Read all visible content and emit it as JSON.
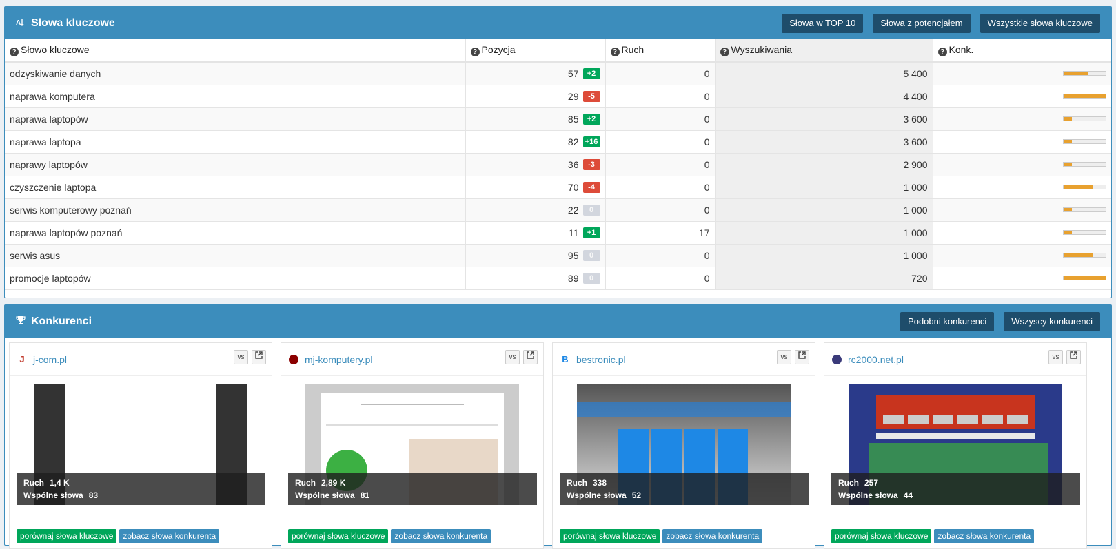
{
  "keywords_panel": {
    "title": "Słowa kluczowe",
    "buttons": [
      "Słowa w TOP 10",
      "Słowa z potencjałem",
      "Wszystkie słowa kluczowe"
    ],
    "columns": [
      "Słowo kluczowe",
      "Pozycja",
      "Ruch",
      "Wyszukiwania",
      "Konk."
    ],
    "rows": [
      {
        "keyword": "odzyskiwanie danych",
        "position": "57",
        "change": "+2",
        "change_type": "up",
        "traffic": "0",
        "searches": "5 400",
        "competition": 0.58
      },
      {
        "keyword": "naprawa komputera",
        "position": "29",
        "change": "-5",
        "change_type": "down",
        "traffic": "0",
        "searches": "4 400",
        "competition": 1.0
      },
      {
        "keyword": "naprawa laptopów",
        "position": "85",
        "change": "+2",
        "change_type": "up",
        "traffic": "0",
        "searches": "3 600",
        "competition": 0.2
      },
      {
        "keyword": "naprawa laptopa",
        "position": "82",
        "change": "+16",
        "change_type": "up",
        "traffic": "0",
        "searches": "3 600",
        "competition": 0.2
      },
      {
        "keyword": "naprawy laptopów",
        "position": "36",
        "change": "-3",
        "change_type": "down",
        "traffic": "0",
        "searches": "2 900",
        "competition": 0.2
      },
      {
        "keyword": "czyszczenie laptopa",
        "position": "70",
        "change": "-4",
        "change_type": "down",
        "traffic": "0",
        "searches": "1 000",
        "competition": 0.7
      },
      {
        "keyword": "serwis komputerowy poznań",
        "position": "22",
        "change": "0",
        "change_type": "zero",
        "traffic": "0",
        "searches": "1 000",
        "competition": 0.2
      },
      {
        "keyword": "naprawa laptopów poznań",
        "position": "11",
        "change": "+1",
        "change_type": "up",
        "traffic": "17",
        "searches": "1 000",
        "competition": 0.2
      },
      {
        "keyword": "serwis asus",
        "position": "95",
        "change": "0",
        "change_type": "zero",
        "traffic": "0",
        "searches": "1 000",
        "competition": 0.7
      },
      {
        "keyword": "promocje laptopów",
        "position": "89",
        "change": "0",
        "change_type": "zero",
        "traffic": "0",
        "searches": "720",
        "competition": 1.0
      }
    ]
  },
  "competitors_panel": {
    "title": "Konkurenci",
    "buttons": [
      "Podobni konkurenci",
      "Wszyscy konkurenci"
    ],
    "vs_label": "vs",
    "traffic_label": "Ruch",
    "common_label": "Wspólne słowa",
    "compare_label": "porównaj słowa kluczowe",
    "view_label": "zobacz słowa konkurenta",
    "cards": [
      {
        "domain": "j-com.pl",
        "favicon": "J",
        "favicon_color": "#c0392b",
        "traffic": "1,4 K",
        "common": "83"
      },
      {
        "domain": "mj-komputery.pl",
        "favicon": "",
        "favicon_color": "#8b0000",
        "traffic": "2,89 K",
        "common": "81"
      },
      {
        "domain": "bestronic.pl",
        "favicon": "B",
        "favicon_color": "#1e88e5",
        "traffic": "338",
        "common": "52"
      },
      {
        "domain": "rc2000.net.pl",
        "favicon": "",
        "favicon_color": "#3a3a7a",
        "traffic": "257",
        "common": "44"
      }
    ]
  }
}
